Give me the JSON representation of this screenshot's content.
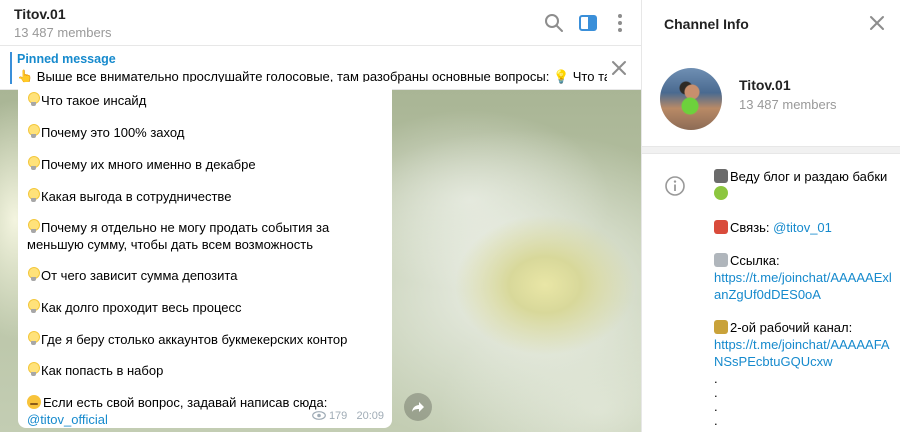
{
  "chat": {
    "title": "Titov.01",
    "subtitle": "13 487 members"
  },
  "pinned": {
    "label": "Pinned message",
    "text": "👆 Выше все внимательно прослушайте голосовые, там разобраны основные вопросы: 💡 Что такое..."
  },
  "message": {
    "lines": [
      "Что такое инсайд",
      "Почему это 100% заход",
      "Почему их много именно в декабре",
      "Какая выгода в сотрудничестве",
      "Почему я отдельно не могу продать события за меньшую сумму, чтобы дать всем возможность",
      "От чего зависит сумма депозита",
      "Как долго проходит весь процесс",
      "Где я беру столько аккаунтов букмекерских контор",
      "Как попасть в набор"
    ],
    "footer_text": "Если есть свой вопрос, задавай написав сюда: ",
    "footer_link": "@titov_official",
    "views": "179",
    "time": "20:09"
  },
  "info_panel": {
    "header": "Channel Info",
    "name": "Titov.01",
    "members": "13 487 members",
    "description": {
      "line1": "Веду блог и раздаю бабки",
      "contact_label": "Связь: ",
      "contact_link": "@titov_01",
      "link1_label": "Ссылка:",
      "link1": "https://t.me/joinchat/AAAAAExlanZgUf0dDES0oA",
      "channel2_label": "2-ой рабочий канал:",
      "link2": "https://t.me/joinchat/AAAAAFANSsPEcbtuGQUcxw",
      "dots": [
        ".",
        ".",
        ".",
        "."
      ]
    }
  },
  "icons": {
    "search": "search-icon",
    "sidebar_toggle": "sidebar-toggle-icon",
    "more": "more-vertical-icon",
    "close": "close-icon",
    "info": "info-icon",
    "share": "share-icon",
    "views": "eye-icon",
    "bulb": "light-bulb-icon"
  },
  "colors": {
    "accent": "#168acd",
    "pinned_bar": "#3a8fd9",
    "muted": "#999999"
  }
}
